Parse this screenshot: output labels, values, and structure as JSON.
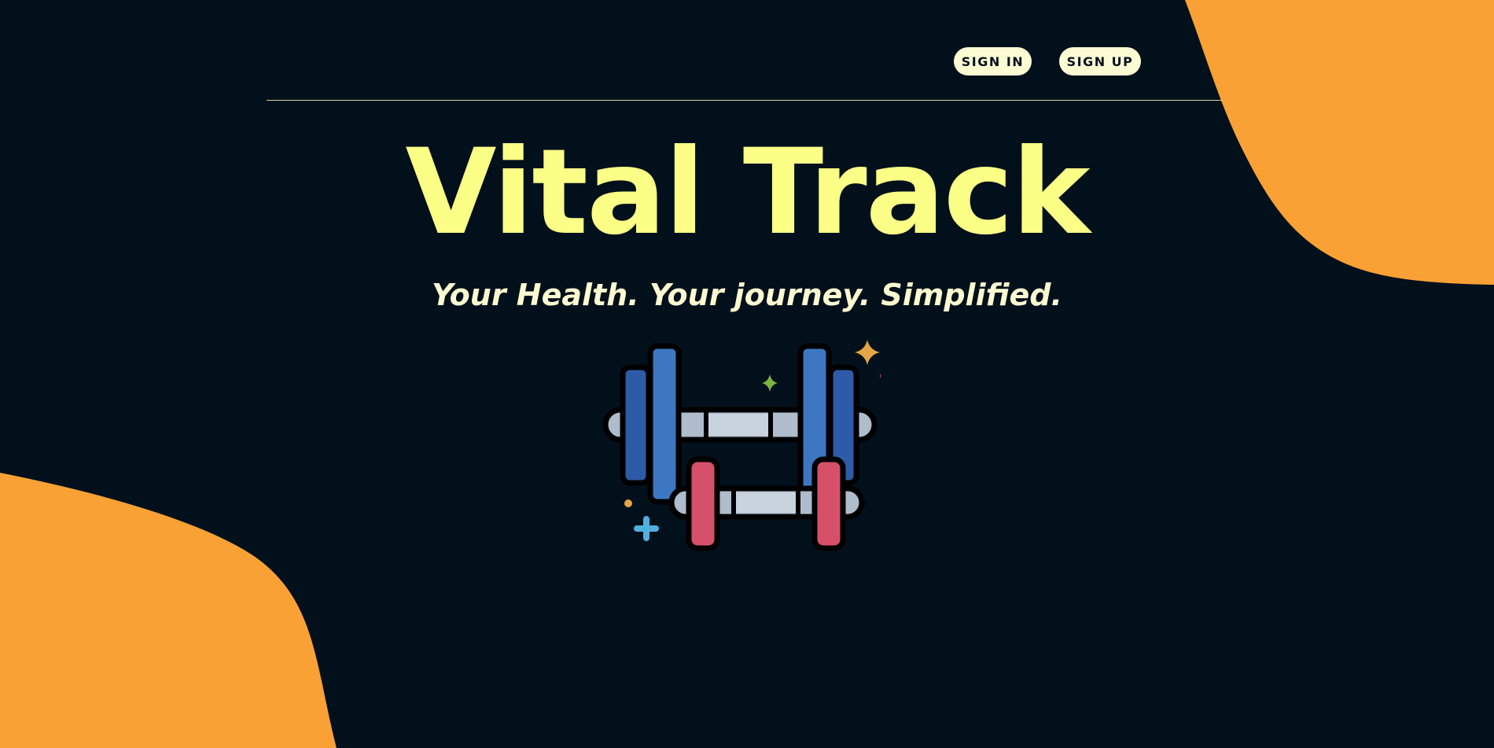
{
  "header": {
    "sign_in_label": "SIGN IN",
    "sign_up_label": "SIGN UP"
  },
  "hero": {
    "title": "Vital Track",
    "tagline": "Your Health. Your journey. Simplified."
  },
  "illustration": {
    "icon": "dumbbells-icon"
  },
  "colors": {
    "background": "#02101c",
    "accent_orange": "#f9a134",
    "title_yellow": "#fcff86",
    "button_bg": "#fdfbd3"
  }
}
